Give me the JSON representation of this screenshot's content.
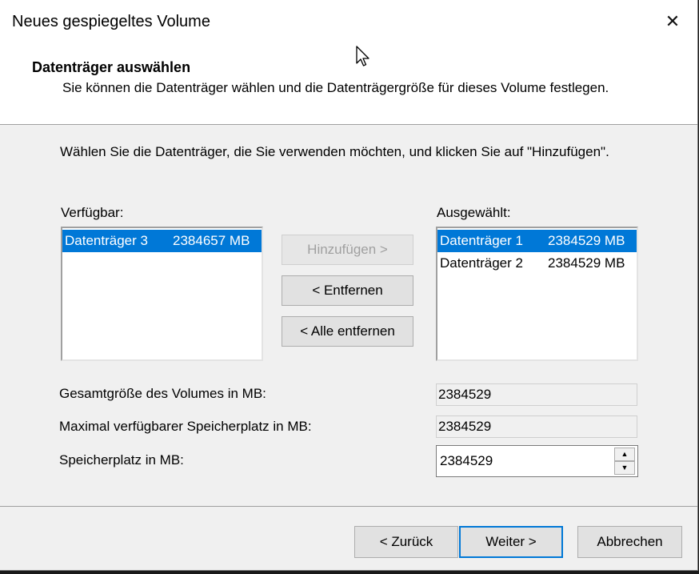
{
  "window": {
    "title": "Neues gespiegeltes Volume",
    "close_glyph": "✕"
  },
  "header": {
    "title": "Datenträger auswählen",
    "description": "Sie können die Datenträger wählen und die Datenträgergröße für dieses Volume festlegen."
  },
  "instruction": "Wählen Sie die Datenträger, die Sie verwenden möchten, und klicken Sie auf \"Hinzufügen\".",
  "available": {
    "label": "Verfügbar:",
    "items": [
      {
        "name": "Datenträger 3",
        "size": "2384657 MB",
        "selected": true
      }
    ]
  },
  "selected": {
    "label": "Ausgewählt:",
    "items": [
      {
        "name": "Datenträger 1",
        "size": "2384529 MB",
        "selected": true
      },
      {
        "name": "Datenträger 2",
        "size": "2384529 MB",
        "selected": false
      }
    ]
  },
  "buttons": {
    "add": "Hinzufügen >",
    "remove": "< Entfernen",
    "remove_all": "< Alle entfernen",
    "back": "< Zurück",
    "next": "Weiter >",
    "cancel": "Abbrechen"
  },
  "fields": {
    "total_label": "Gesamtgröße des Volumes in MB:",
    "total_value": "2384529",
    "max_label": "Maximal verfügbarer Speicherplatz in MB:",
    "max_value": "2384529",
    "space_label": "Speicherplatz in MB:",
    "space_value": "2384529"
  },
  "icons": {
    "spin_up": "▲",
    "spin_down": "▼",
    "cursor": "mouse-pointer-icon"
  },
  "colors": {
    "selection": "#0078d7",
    "dialog_bg": "#f0f0f0"
  }
}
